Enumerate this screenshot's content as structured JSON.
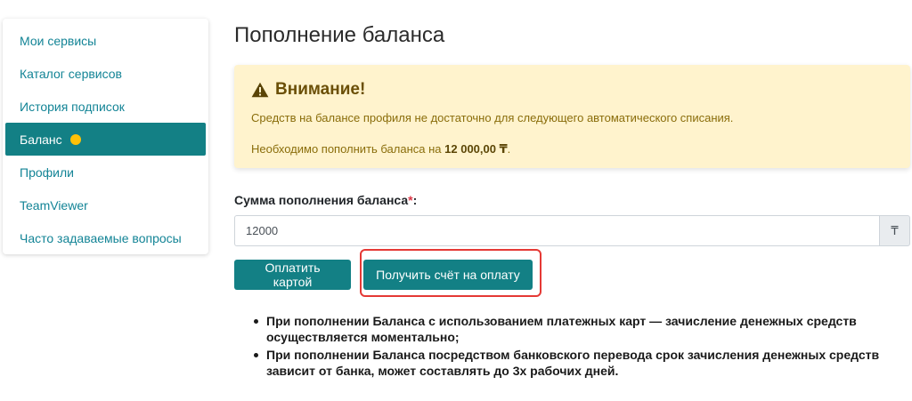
{
  "sidebar": {
    "items": [
      {
        "label": "Мои сервисы"
      },
      {
        "label": "Каталог сервисов"
      },
      {
        "label": "История подписок"
      },
      {
        "label": "Баланс"
      },
      {
        "label": "Профили"
      },
      {
        "label": "TeamViewer"
      },
      {
        "label": "Часто задаваемые вопросы"
      }
    ],
    "active_index": 3,
    "badge_color": "#ffc107"
  },
  "page": {
    "title": "Пополнение баланса"
  },
  "alert": {
    "icon": "warning-triangle-icon",
    "title": "Внимание!",
    "message": "Средств на балансе профиля не достаточно для следующего автоматического списания.",
    "required_prefix": "Необходимо пополнить баланса на ",
    "required_amount": "12 000,00 ₸",
    "required_suffix": "."
  },
  "form": {
    "amount_label": "Сумма пополнения баланса",
    "required_mark": "*",
    "label_suffix": ":",
    "amount_value": "12000",
    "currency_symbol": "₸"
  },
  "buttons": {
    "pay_card": "Оплатить картой",
    "get_invoice": "Получить счёт на оплату"
  },
  "notes": [
    "При пополнении Баланса с использованием платежных карт — зачисление денежных средств осуществляется моментально;",
    "При пополнении Баланса посредством банковского перевода срок зачисления денежных средств зависит от банка, может составлять до 3х рабочих дней."
  ],
  "colors": {
    "accent": "#138085",
    "alert_bg": "#fff3cd",
    "highlight": "#e53935"
  }
}
